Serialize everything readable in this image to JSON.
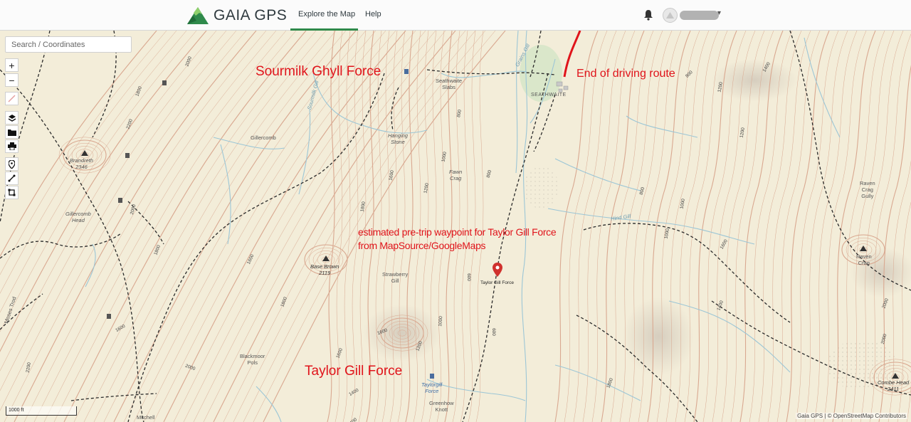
{
  "header": {
    "logo_text": "GAIA GPS",
    "nav": [
      {
        "label": "Explore the Map",
        "active": true
      },
      {
        "label": "Help",
        "active": false
      }
    ],
    "accent_color": "#2f8a4b"
  },
  "search": {
    "placeholder": "Search / Coordinates"
  },
  "tools": [
    "zoom-in",
    "zoom-out",
    "ruler",
    "layers",
    "folder",
    "print",
    "waypoint",
    "line",
    "area"
  ],
  "annotations": {
    "sourmilk": "Sourmilk Ghyll Force",
    "end_route": "End of driving route",
    "estimated_line1": "estimated pre-trip waypoint for Taylor Gill Force",
    "estimated_line2": "from MapSource/GoogleMaps",
    "taylor": "Taylor Gill Force"
  },
  "waypoint": {
    "label": "Taylor Gill Force",
    "color": "#d0312d"
  },
  "map_labels": {
    "brandreth": "Brandreth",
    "brandreth_elev": "2346",
    "gillercomb_head_1": "Gillercomb",
    "gillercomb_head_2": "Head",
    "base_brown": "Base Brown",
    "base_brown_elev": "2119",
    "gillercomb": "Gillercomb",
    "hanging_stone_1": "Hanging",
    "hanging_stone_2": "Stone",
    "fawn_crag_1": "Fawn",
    "fawn_crag_2": "Crag",
    "strawberry_1": "Strawberry",
    "strawberry_2": "Gill",
    "blackmoor_1": "Blackmoor",
    "blackmoor_2": "Pols",
    "taylorgill_1": "Taylorgill",
    "taylorgill_2": "Force",
    "greenhow_1": "Greenhow",
    "greenhow_2": "Knott",
    "mitchell": "Mitchell",
    "seathwaite": "SEATHWAITE",
    "seathwaite_slabs_1": "Seathwaite",
    "seathwaite_slabs_2": "Slabs",
    "grains_gill": "Grains Gill",
    "sourmilk_gill": "Sourmilk Gill",
    "hind_gill": "Hind Gill",
    "raven_crag_gully_1": "Raven",
    "raven_crag_gully_2": "Crag",
    "raven_crag_gully_3": "Gully",
    "raven_crag_1": "Raven",
    "raven_crag_2": "Crag",
    "combe_head": "Combe Head",
    "combe_head_elev": "2411",
    "moses_trod": "Moses Trod"
  },
  "contour_labels": {
    "c1": "2000",
    "c2": "1800",
    "c3": "2200",
    "c4": "2000",
    "c5": "1600",
    "c6": "1800",
    "c7": "1600",
    "c8": "1200",
    "c9": "1000",
    "c10": "800",
    "c11": "1800",
    "c12": "1600",
    "c13": "800",
    "c14": "1000",
    "c15": "1200",
    "c16": "1600",
    "c17": "1400",
    "c18": "1600",
    "c19": "1800",
    "c20": "1000",
    "c21": "600",
    "c22": "800",
    "c23": "1600",
    "c24": "1800",
    "c25": "2000",
    "c26": "2200",
    "c27": "1400",
    "c28": "1200",
    "c29": "1400",
    "c30": "2000",
    "c31": "1400",
    "c32": "1200",
    "c33": "1000",
    "c34": "2000",
    "c35": "800",
    "c36": "600"
  },
  "scale": {
    "label": "1000 ft"
  },
  "attribution": "Gaia GPS | © OpenStreetMap Contributors",
  "colors": {
    "map_bg": "#f3edd9",
    "contour": "#d9a890",
    "water": "#9cc6d6",
    "trail": "#2a2a2a",
    "annotation": "#e0141b"
  }
}
